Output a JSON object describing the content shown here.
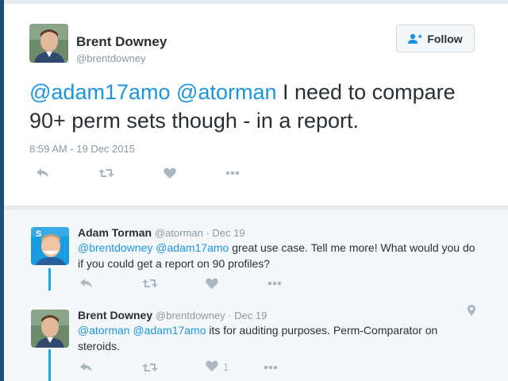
{
  "colors": {
    "accent": "#1b95e0",
    "thread_line": "#1da1f2",
    "muted": "#8899a6",
    "icon": "#aab8c2",
    "text": "#292f33"
  },
  "main_tweet": {
    "name": "Brent Downey",
    "handle": "@brentdowney",
    "follow_label": "Follow",
    "follow_icon": "follow-user-icon",
    "text_mention_1": "@adam17amo",
    "text_mention_2": "@atorman",
    "text_rest_line1": " I need to compare",
    "text_line2": "90+ perm sets though - in a report.",
    "timestamp": "8:59 AM - 19 Dec 2015",
    "actions": [
      "reply-icon",
      "retweet-icon",
      "like-icon",
      "more-icon"
    ]
  },
  "replies": [
    {
      "name": "Adam Torman",
      "meta": "@atorman · Dec 19",
      "mention_1": "@brentdowney",
      "mention_2": "@adam17amo",
      "text_line1_rest": " great use case. Tell me more! What would you do",
      "text_line2": "if you could get a report on 90 profiles?",
      "like_count": ""
    },
    {
      "name": "Brent Downey",
      "meta": "@brentdowney · Dec 19",
      "mention_1": "@atorman",
      "mention_2": "@adam17amo",
      "text_line1_rest": " its for auditing purposes. Perm-Comparator on",
      "text_line2": "steroids.",
      "like_count": "1",
      "location_icon": "location-pin-icon"
    }
  ]
}
